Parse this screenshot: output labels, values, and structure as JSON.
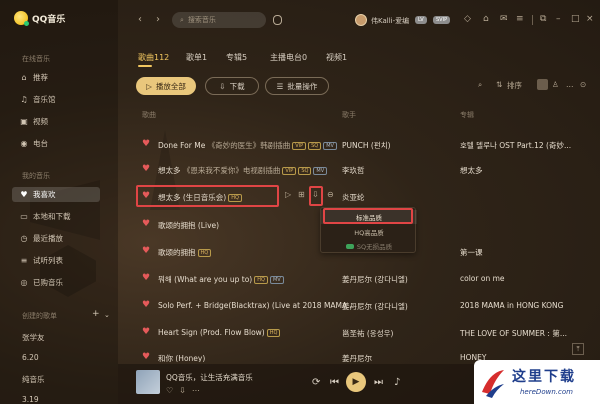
{
  "app": {
    "name": "QQ音乐"
  },
  "sidebar": {
    "section_online": "在线音乐",
    "online_items": [
      {
        "label": "推荐",
        "icon": "home-icon"
      },
      {
        "label": "音乐馆",
        "icon": "music-note-icon"
      },
      {
        "label": "视频",
        "icon": "video-icon"
      },
      {
        "label": "电台",
        "icon": "radio-icon"
      }
    ],
    "section_mine": "我的音乐",
    "mine_items": [
      {
        "label": "我喜欢",
        "icon": "heart-icon"
      },
      {
        "label": "本地和下载",
        "icon": "computer-icon"
      },
      {
        "label": "最近播放",
        "icon": "clock-icon"
      },
      {
        "label": "试听列表",
        "icon": "playlist-icon"
      },
      {
        "label": "已购音乐",
        "icon": "purchased-icon"
      }
    ],
    "section_created": "创建的歌单",
    "playlists": [
      "张学友",
      "6.20",
      "纯音乐",
      "3.19"
    ]
  },
  "topbar": {
    "search_placeholder": "搜索音乐",
    "username": "伟Kalli-爱编",
    "vip_label": "LV",
    "svip_label": "SVIP"
  },
  "tabs": [
    {
      "label": "歌曲112",
      "active": true
    },
    {
      "label": "歌单1",
      "active": false
    },
    {
      "label": "专辑5",
      "active": false
    },
    {
      "label": "主播电台0",
      "active": false
    },
    {
      "label": "视频1",
      "active": false
    }
  ],
  "actions": {
    "play_all": "播放全部",
    "download": "下载",
    "batch": "批量操作",
    "sort": "排序"
  },
  "columns": {
    "song": "歌曲",
    "artist": "歌手",
    "album": "专辑"
  },
  "songs": [
    {
      "title": "Done For Me",
      "subtitle": "《奇妙的医生》韩剧插曲",
      "tags": [
        "VIP",
        "SQ",
        "MV"
      ],
      "artist": "PUNCH (펀치)",
      "album": "호텔 델루나 OST Part.12 (奇妙..."
    },
    {
      "title": "想太多",
      "subtitle": "《恩来我不爱你》电视剧插曲",
      "tags": [
        "VIP",
        "SQ",
        "MV"
      ],
      "artist": "李玖哲",
      "album": "想太多"
    },
    {
      "title": "想太多 (生日音乐会)",
      "subtitle": "",
      "tags": [
        "HQ"
      ],
      "artist": "炎亚纶",
      "album": ""
    },
    {
      "title": "歌颂的拥抱 (Live)",
      "subtitle": "",
      "tags": [],
      "artist": "",
      "album": ""
    },
    {
      "title": "歌颂的拥抱",
      "subtitle": "",
      "tags": [
        "HQ"
      ],
      "artist": "",
      "album": "第一课"
    },
    {
      "title": "뭐해 (What are you up to)",
      "subtitle": "",
      "tags": [
        "HQ",
        "MV"
      ],
      "artist": "姜丹尼尔 (강다니엘)",
      "album": "color on me"
    },
    {
      "title": "Solo Perf. + Bridge(Blacktrax) (Live at 2018 MAMA...",
      "subtitle": "",
      "tags": [],
      "artist": "姜丹尼尔 (강다니엘)",
      "album": "2018 MAMA in HONG KONG"
    },
    {
      "title": "Heart Sign (Prod. Flow Blow)",
      "subtitle": "",
      "tags": [
        "HQ"
      ],
      "artist": "邕圣祐 (옹성우)",
      "album": "THE LOVE OF SUMMER : 第..."
    },
    {
      "title": "和你 (Honey)",
      "subtitle": "",
      "tags": [],
      "artist": "姜丹尼尔",
      "album": "HONEY"
    }
  ],
  "quality_menu": {
    "options": [
      "标准品质",
      "HQ高品质",
      "SQ无损品质"
    ],
    "selected": "标准品质"
  },
  "player": {
    "now_playing": "QQ音乐，让生活充满音乐"
  },
  "watermark": {
    "text": "这里下载",
    "url": "hereDown.com"
  },
  "colors": {
    "accent": "#e9c77c",
    "heart": "#e55a5a",
    "highlight": "#e04545"
  }
}
